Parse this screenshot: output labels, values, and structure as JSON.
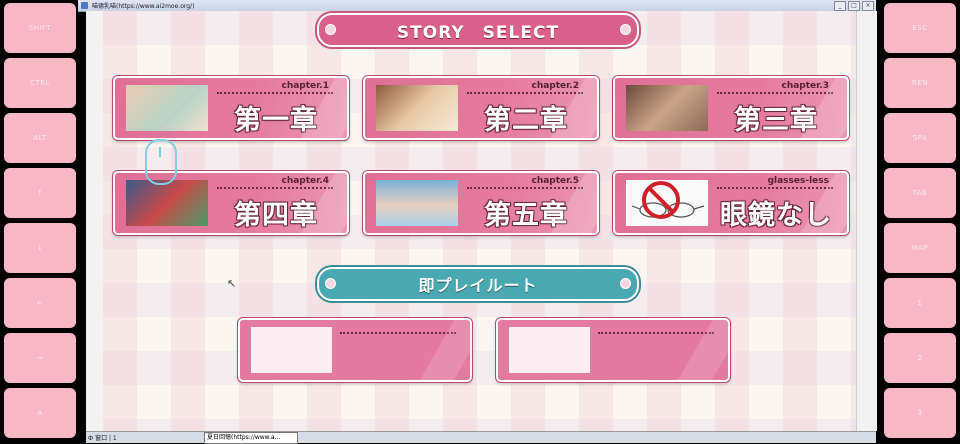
{
  "window": {
    "title": "喵德乳喵(https://www.ai2moe.org/)",
    "buttons": [
      "_",
      "□",
      "×"
    ]
  },
  "left_keys": [
    "SHIFT",
    "CTRL",
    "ALT",
    "↑",
    "↓",
    "←",
    "→",
    "A"
  ],
  "right_keys": [
    "ESC",
    "REN",
    "SPA",
    "TAB",
    "MAP",
    "1",
    "2",
    "3"
  ],
  "header": {
    "title": "STORY　SELECT"
  },
  "chapters": [
    {
      "tag": "chapter.1",
      "label": "第一章"
    },
    {
      "tag": "chapter.2",
      "label": "第二章"
    },
    {
      "tag": "chapter.3",
      "label": "第三章"
    },
    {
      "tag": "chapter.4",
      "label": "第四章"
    },
    {
      "tag": "chapter.5",
      "label": "第五章"
    },
    {
      "tag": "glasses-less",
      "label": "眼鏡なし"
    }
  ],
  "quick_route": {
    "title": "即プレイルート"
  },
  "statusbar": {
    "left": "Ф 窗口 | 1",
    "task": "夏日回憶(https://www.a..."
  },
  "colors": {
    "accent_pink": "#d9608a",
    "accent_teal": "#4aa8b0",
    "key_pink": "#f7b7c4"
  }
}
